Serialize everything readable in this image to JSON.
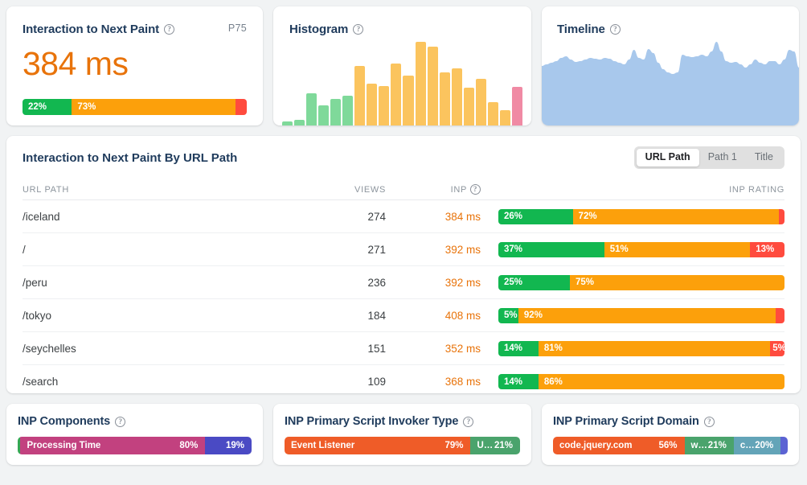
{
  "inp_card": {
    "title": "Interaction to Next Paint",
    "help_glyph": "?",
    "percentile_label": "P75",
    "value": "384 ms",
    "bar": [
      {
        "label": "22%",
        "pct": 22,
        "color": "#12b750"
      },
      {
        "label": "73%",
        "pct": 73,
        "color": "#fca00b"
      },
      {
        "label": "",
        "pct": 5,
        "color": "#ff4b3e"
      }
    ]
  },
  "histogram_card": {
    "title": "Histogram",
    "help_glyph": "?"
  },
  "timeline_card": {
    "title": "Timeline",
    "help_glyph": "?",
    "area_color": "#a8c8ec"
  },
  "table_card": {
    "title": "Interaction to Next Paint By URL Path",
    "segmented_control": {
      "options": [
        "URL Path",
        "Path 1",
        "Title"
      ],
      "selected": "URL Path"
    },
    "columns": {
      "path": "URL PATH",
      "views": "VIEWS",
      "inp": "INP",
      "inp_help_glyph": "?",
      "rating": "INP RATING"
    },
    "rows": [
      {
        "path": "/iceland",
        "views": "274",
        "inp": "384 ms",
        "rating": [
          {
            "label": "26%",
            "pct": 26,
            "color": "#12b750"
          },
          {
            "label": "72%",
            "pct": 72,
            "color": "#fca00b"
          },
          {
            "label": "",
            "pct": 2,
            "color": "#ff4b3e"
          }
        ]
      },
      {
        "path": "/",
        "views": "271",
        "inp": "392 ms",
        "rating": [
          {
            "label": "37%",
            "pct": 37,
            "color": "#12b750"
          },
          {
            "label": "51%",
            "pct": 51,
            "color": "#fca00b"
          },
          {
            "label": "13%",
            "pct": 12,
            "color": "#ff4b3e"
          }
        ]
      },
      {
        "path": "/peru",
        "views": "236",
        "inp": "392 ms",
        "rating": [
          {
            "label": "25%",
            "pct": 25,
            "color": "#12b750"
          },
          {
            "label": "75%",
            "pct": 75,
            "color": "#fca00b"
          }
        ]
      },
      {
        "path": "/tokyo",
        "views": "184",
        "inp": "408 ms",
        "rating": [
          {
            "label": "5%",
            "pct": 7,
            "color": "#12b750"
          },
          {
            "label": "92%",
            "pct": 90,
            "color": "#fca00b"
          },
          {
            "label": "",
            "pct": 3,
            "color": "#ff4b3e"
          }
        ]
      },
      {
        "path": "/seychelles",
        "views": "151",
        "inp": "352 ms",
        "rating": [
          {
            "label": "14%",
            "pct": 14,
            "color": "#12b750"
          },
          {
            "label": "81%",
            "pct": 81,
            "color": "#fca00b"
          },
          {
            "label": "5%",
            "pct": 5,
            "color": "#ff4b3e"
          }
        ]
      },
      {
        "path": "/search",
        "views": "109",
        "inp": "368 ms",
        "rating": [
          {
            "label": "14%",
            "pct": 14,
            "color": "#12b750"
          },
          {
            "label": "86%",
            "pct": 86,
            "color": "#fca00b"
          }
        ]
      }
    ]
  },
  "components_card": {
    "title": "INP Components",
    "help_glyph": "?",
    "bar": [
      {
        "label": "",
        "pct": 1.2,
        "color": "#34a853"
      },
      {
        "label": "Processing Time",
        "pct": 79,
        "value": "80%",
        "color": "#c2417f"
      },
      {
        "label": "",
        "pct": 19.8,
        "value": "19%",
        "color": "#4a4ac4"
      }
    ]
  },
  "invoker_card": {
    "title": "INP Primary Script Invoker Type",
    "help_glyph": "?",
    "bar": [
      {
        "label": "Event Listener",
        "pct": 79,
        "value": "79%",
        "color": "#ef5c28"
      },
      {
        "label": "U…",
        "pct": 21,
        "value": "21%",
        "color": "#4aa36c"
      }
    ]
  },
  "domain_card": {
    "title": "INP Primary Script Domain",
    "help_glyph": "?",
    "bar": [
      {
        "label": "code.jquery.com",
        "pct": 56,
        "value": "56%",
        "color": "#ef5c28"
      },
      {
        "label": "w…",
        "pct": 21,
        "value": "21%",
        "color": "#4aa36c"
      },
      {
        "label": "c…",
        "pct": 20,
        "value": "20%",
        "color": "#63a4b8"
      },
      {
        "label": "",
        "pct": 3,
        "value": "",
        "color": "#5b63d3"
      }
    ]
  },
  "chart_data": [
    {
      "type": "bar",
      "title": "Histogram",
      "xlabel": "",
      "ylabel": "",
      "categories": [
        "b1",
        "b2",
        "b3",
        "b4",
        "b5",
        "b6",
        "b7",
        "b8",
        "b9",
        "b10",
        "b11",
        "b12",
        "b13",
        "b14",
        "b15",
        "b16",
        "b17",
        "b18",
        "b19",
        "b20"
      ],
      "values": [
        4,
        5,
        29,
        18,
        24,
        27,
        54,
        38,
        36,
        56,
        45,
        76,
        71,
        48,
        52,
        34,
        42,
        21,
        14,
        35
      ],
      "colors": [
        "#7fd99a",
        "#7fd99a",
        "#7fd99a",
        "#7fd99a",
        "#7fd99a",
        "#7fd99a",
        "#fbc45e",
        "#fbc45e",
        "#fbc45e",
        "#fbc45e",
        "#fbc45e",
        "#fbc45e",
        "#fbc45e",
        "#fbc45e",
        "#fbc45e",
        "#fbc45e",
        "#fbc45e",
        "#fbc45e",
        "#fbc45e",
        "#f08aa4"
      ],
      "ylim": [
        0,
        80
      ],
      "grid": false,
      "legend": "none"
    },
    {
      "type": "area",
      "title": "Timeline",
      "xlabel": "",
      "ylabel": "",
      "x": [
        0,
        1,
        2,
        3,
        4,
        5,
        6,
        7,
        8,
        9,
        10,
        11,
        12,
        13,
        14,
        15,
        16,
        17,
        18,
        19,
        20,
        21,
        22,
        23,
        24,
        25,
        26,
        27,
        28,
        29,
        30,
        31,
        32,
        33,
        34,
        35,
        36,
        37,
        38,
        39,
        40,
        41,
        42,
        43,
        44,
        45,
        46,
        47,
        48,
        49,
        50,
        51,
        52,
        53
      ],
      "values": [
        74,
        76,
        78,
        80,
        84,
        86,
        82,
        79,
        80,
        82,
        84,
        83,
        82,
        84,
        83,
        80,
        78,
        76,
        82,
        94,
        84,
        82,
        95,
        90,
        78,
        70,
        66,
        64,
        66,
        88,
        86,
        85,
        86,
        88,
        86,
        92,
        104,
        92,
        80,
        78,
        79,
        76,
        72,
        76,
        82,
        78,
        76,
        80,
        80,
        76,
        82,
        94,
        92,
        72
      ],
      "ylim": [
        0,
        122
      ],
      "grid": false,
      "legend": "none"
    }
  ]
}
